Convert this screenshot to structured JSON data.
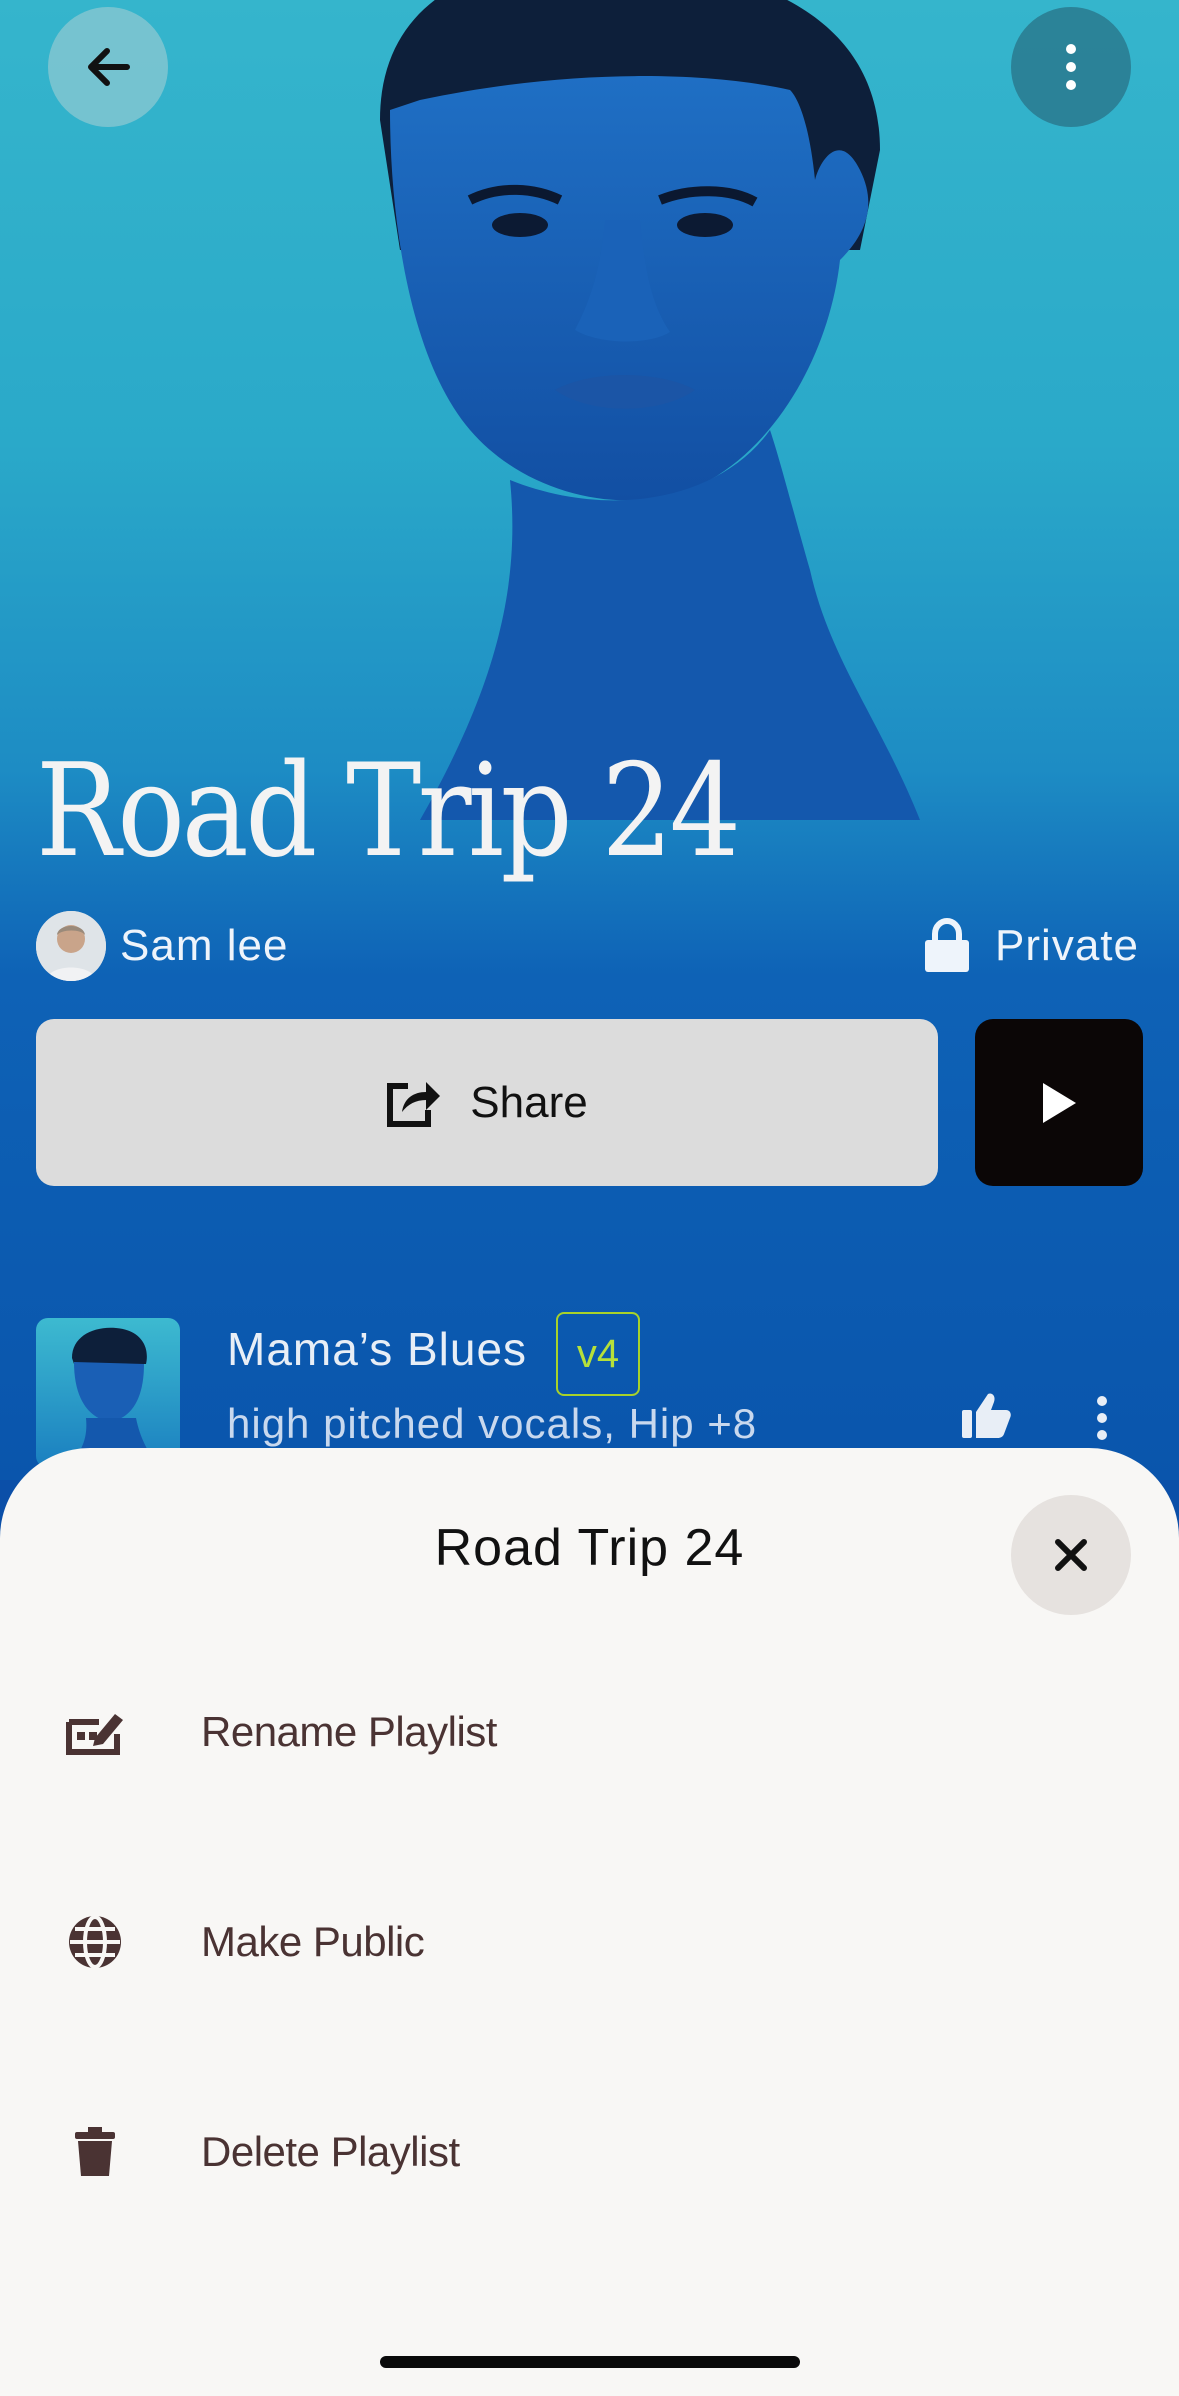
{
  "playlist": {
    "title": "Road Trip 24",
    "owner_name": "Sam lee",
    "privacy_label": "Private",
    "share_label": "Share"
  },
  "track": {
    "title": "Mama’s Blues",
    "version": "v4",
    "subtitle": "high pitched vocals, Hip +8"
  },
  "sheet": {
    "title": "Road Trip 24",
    "items": [
      {
        "label": "Rename Playlist",
        "icon": "rename-icon"
      },
      {
        "label": "Make Public",
        "icon": "globe-icon"
      },
      {
        "label": "Delete Playlist",
        "icon": "trash-icon"
      }
    ]
  },
  "colors": {
    "sheet_bg": "#f8f7f5",
    "accent_badge": "#b6e03a",
    "play_button": "#0b0606"
  }
}
